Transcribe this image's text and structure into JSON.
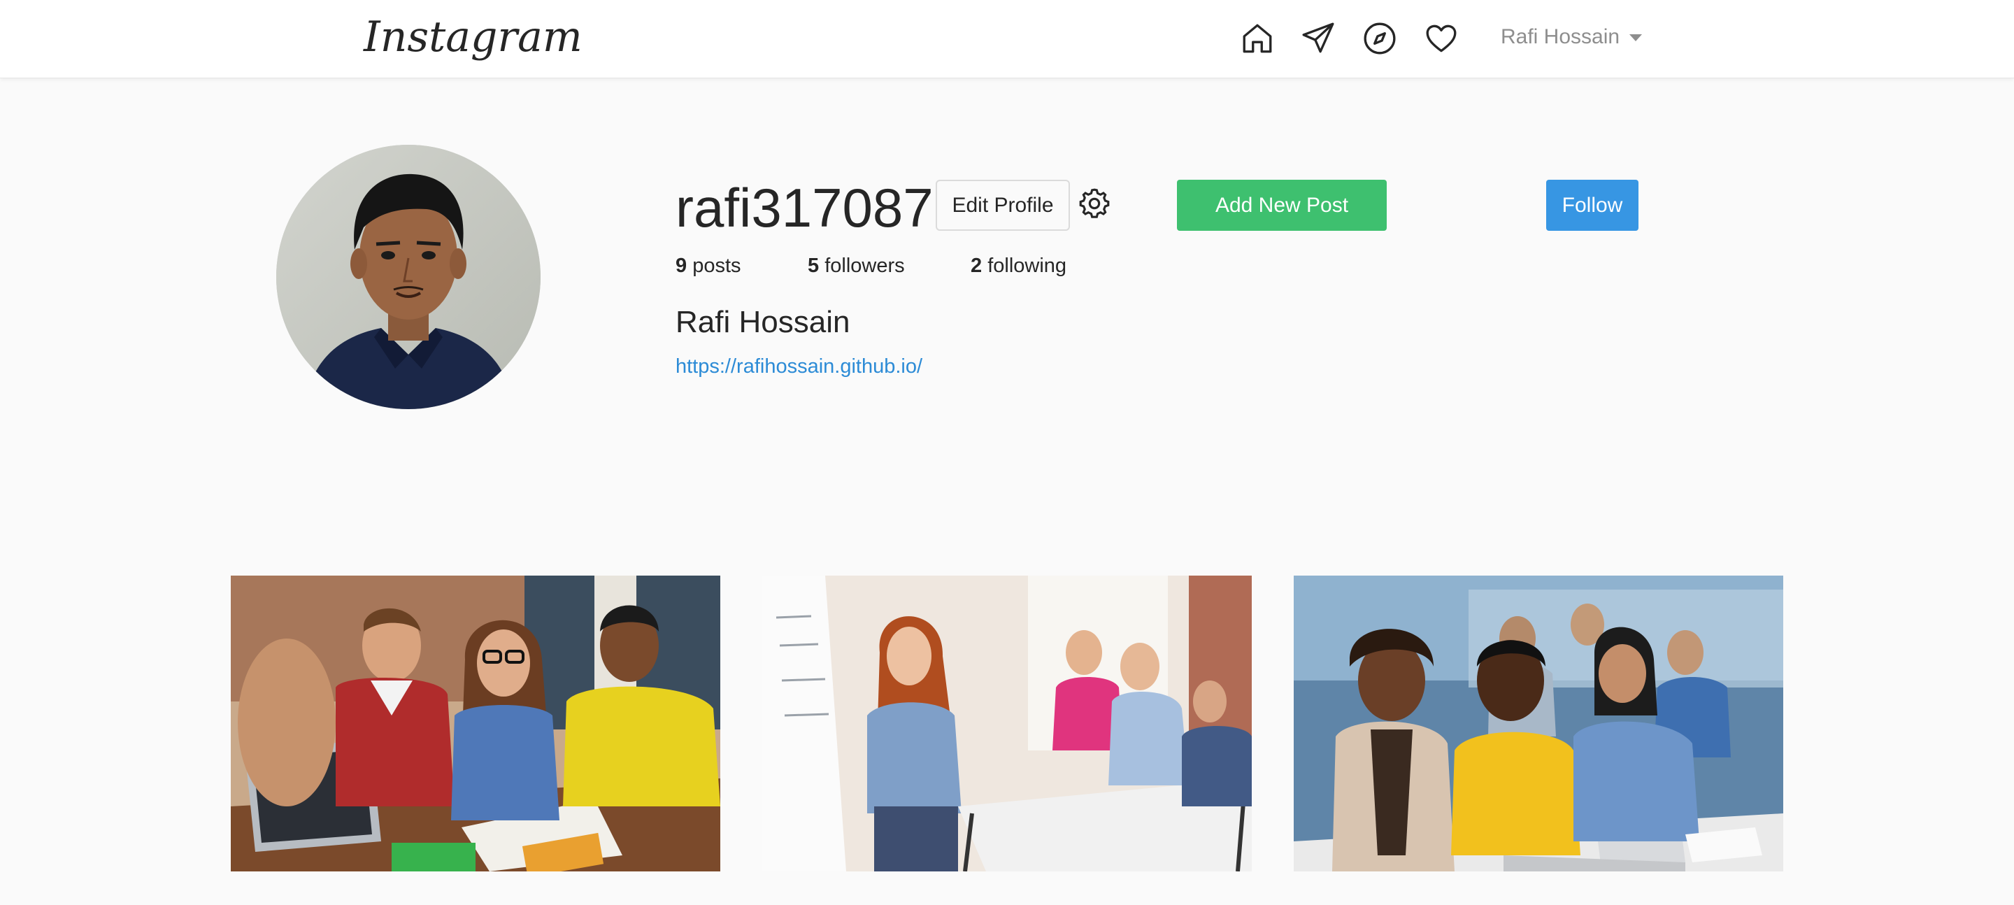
{
  "nav": {
    "logo": "Instagram",
    "icons": [
      "home-icon",
      "send-icon",
      "compass-icon",
      "heart-icon"
    ],
    "user_label": "Rafi Hossain"
  },
  "profile": {
    "username": "rafi317087",
    "edit_label": "Edit Profile",
    "add_post_label": "Add New Post",
    "follow_label": "Follow",
    "posts_count": "9",
    "posts_label": "posts",
    "followers_count": "5",
    "followers_label": "followers",
    "following_count": "2",
    "following_label": "following",
    "full_name": "Rafi Hossain",
    "website": "https://rafihossain.github.io/"
  },
  "colors": {
    "background": "#fafafa",
    "add_button": "#3ec06f",
    "follow_button": "#3796e3",
    "link": "#2c8bd6"
  },
  "posts": [
    {
      "description": "students-group-photo-1"
    },
    {
      "description": "students-group-photo-2"
    },
    {
      "description": "students-group-photo-3"
    }
  ]
}
